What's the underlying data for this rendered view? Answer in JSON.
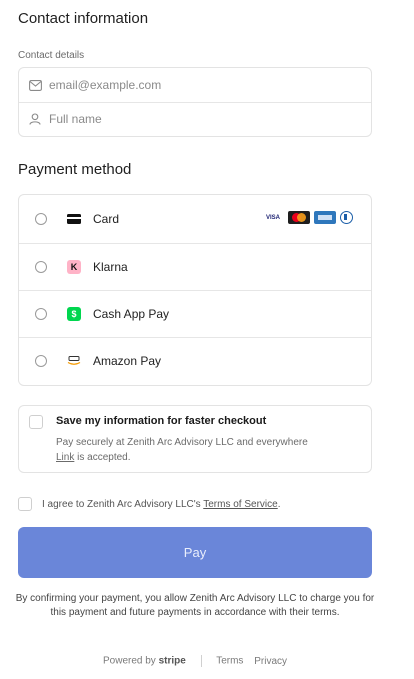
{
  "contact": {
    "title": "Contact information",
    "details_label": "Contact details",
    "email_placeholder": "email@example.com",
    "name_placeholder": "Full name"
  },
  "payment": {
    "title": "Payment method",
    "methods": [
      {
        "label": "Card"
      },
      {
        "label": "Klarna"
      },
      {
        "label": "Cash App Pay"
      },
      {
        "label": "Amazon Pay"
      }
    ],
    "card_brands": [
      "VISA"
    ]
  },
  "save": {
    "title": "Save my information for faster checkout",
    "desc_1": "Pay securely at Zenith Arc Advisory LLC and everywhere",
    "desc_link": "Link",
    "desc_2": " is accepted."
  },
  "terms": {
    "prefix": "I agree to Zenith Arc Advisory LLC's ",
    "link": "Terms of Service",
    "suffix": "."
  },
  "pay_button": "Pay",
  "disclaimer": "By confirming your payment, you allow Zenith Arc Advisory LLC to charge you for this payment and future payments in accordance with their terms.",
  "footer": {
    "powered_by": "Powered by",
    "brand": "stripe",
    "terms": "Terms",
    "privacy": "Privacy"
  },
  "colors": {
    "pay_button": "#6a86d9",
    "klarna": "#ffb3c7",
    "cash_app": "#00d64f"
  }
}
